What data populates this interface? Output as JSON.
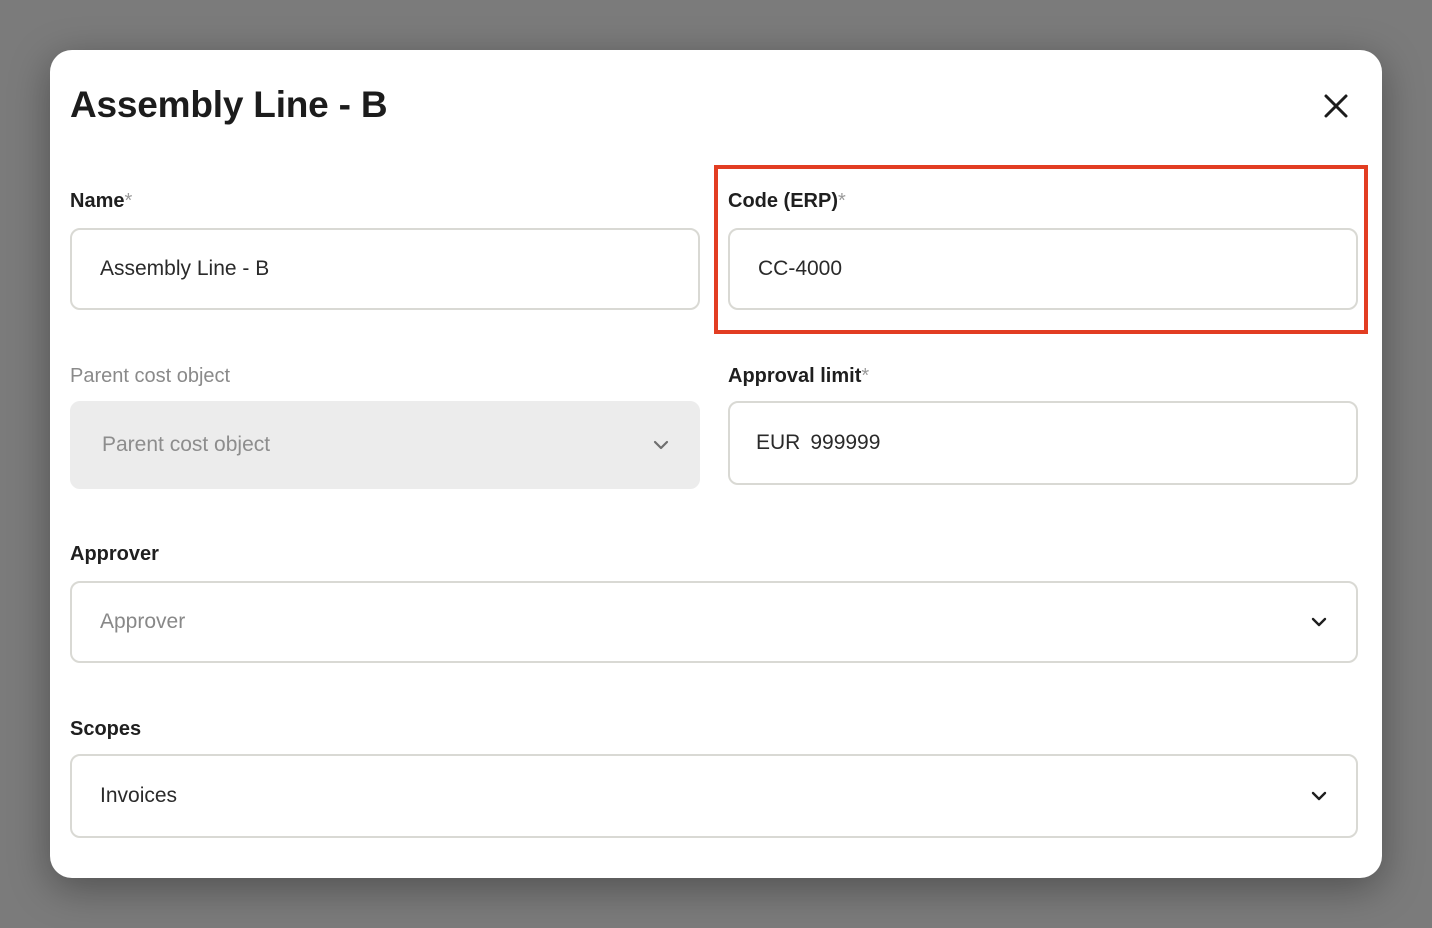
{
  "modal": {
    "title": "Assembly Line - B",
    "close_icon": "close-icon"
  },
  "fields": {
    "name": {
      "label": "Name",
      "required_marker": "*",
      "value": "Assembly Line - B"
    },
    "code": {
      "label": "Code (ERP)",
      "required_marker": "*",
      "value": "CC-4000"
    },
    "parent_cost_object": {
      "label": "Parent cost object",
      "placeholder": "Parent cost object",
      "icon": "chevron-down-icon",
      "disabled": true
    },
    "approval_limit": {
      "label": "Approval limit",
      "required_marker": "*",
      "currency": "EUR",
      "value": "999999"
    },
    "approver": {
      "label": "Approver",
      "placeholder": "Approver",
      "icon": "chevron-down-icon"
    },
    "scopes": {
      "label": "Scopes",
      "value": "Invoices",
      "icon": "chevron-down-icon"
    }
  },
  "colors": {
    "backdrop": "#7b7b7b",
    "modal_bg": "#ffffff",
    "highlight": "#e23d22",
    "input_border": "#d9d9d4",
    "disabled_bg": "#ececec"
  }
}
